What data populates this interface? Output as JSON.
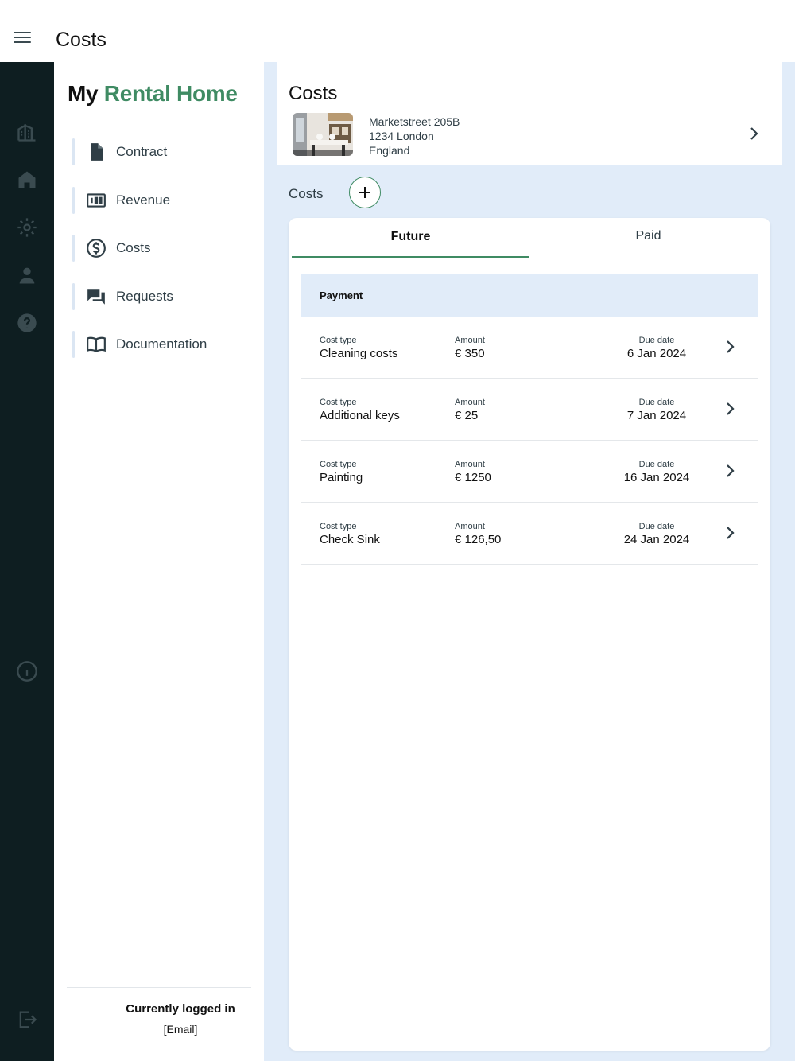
{
  "topbar": {
    "title": "Costs"
  },
  "brand": {
    "my": "My",
    "rental_home": "Rental Home"
  },
  "nav": [
    {
      "label": "Contract",
      "icon": "document-icon"
    },
    {
      "label": "Revenue",
      "icon": "banknote-icon"
    },
    {
      "label": "Costs",
      "icon": "dollar-icon"
    },
    {
      "label": "Requests",
      "icon": "chat-icon"
    },
    {
      "label": "Documentation",
      "icon": "book-icon"
    }
  ],
  "session": {
    "label": "Currently logged in",
    "email": "[Email]"
  },
  "header": {
    "title": "Costs",
    "address": {
      "line1": "Marketstreet 205B",
      "line2": "1234 London",
      "line3": "England"
    }
  },
  "section": {
    "costs_label": "Costs"
  },
  "tabs": {
    "future": "Future",
    "paid": "Paid"
  },
  "list": {
    "heading": "Payment",
    "captions": {
      "type": "Cost type",
      "amount": "Amount",
      "due": "Due date"
    },
    "rows": [
      {
        "type": "Cleaning costs",
        "amount": "€ 350",
        "due": "6 Jan 2024"
      },
      {
        "type": "Additional keys",
        "amount": "€ 25",
        "due": "7 Jan 2024"
      },
      {
        "type": "Painting",
        "amount": "€ 1250",
        "due": "16 Jan 2024"
      },
      {
        "type": "Check Sink",
        "amount": "€ 126,50",
        "due": "24 Jan 2024"
      }
    ]
  },
  "colors": {
    "accent": "#3f8b63",
    "rail": "#0e1e21",
    "panel": "#e1ecf9"
  }
}
